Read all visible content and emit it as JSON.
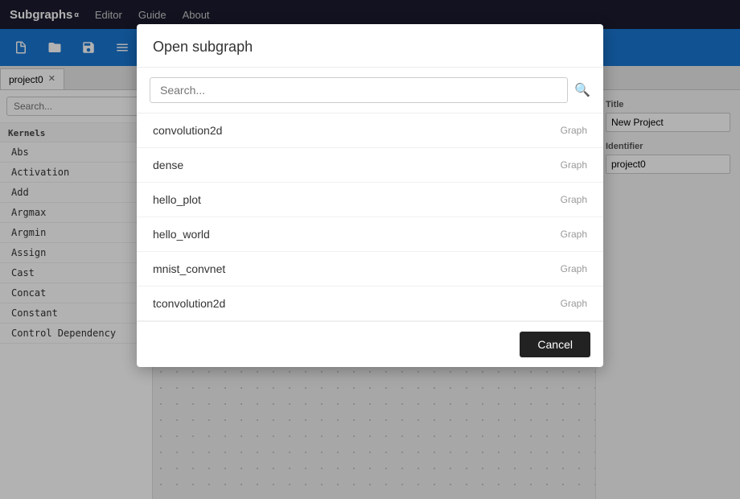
{
  "nav": {
    "brand": "Subgraphs",
    "brand_sup": "α",
    "links": [
      "Editor",
      "Guide",
      "About"
    ]
  },
  "toolbar": {
    "icons": [
      {
        "name": "new-file-icon",
        "symbol": "📄"
      },
      {
        "name": "open-folder-icon",
        "symbol": "📁"
      },
      {
        "name": "save-icon",
        "symbol": "💾"
      },
      {
        "name": "extra-icon",
        "symbol": "📋"
      }
    ]
  },
  "tabs": [
    {
      "label": "project0",
      "closeable": true,
      "active": true
    }
  ],
  "sidebar": {
    "search_placeholder": "Search...",
    "section_label": "Kernels",
    "items": [
      "Abs",
      "Activation",
      "Add",
      "Argmax",
      "Argmin",
      "Assign",
      "Cast",
      "Concat",
      "Constant",
      "Control Dependency"
    ]
  },
  "right_panel": {
    "title_label": "Title",
    "title_value": "New Project",
    "identifier_label": "Identifier",
    "identifier_value": "project0"
  },
  "modal": {
    "title": "Open subgraph",
    "search_placeholder": "Search...",
    "items": [
      {
        "name": "convolution2d",
        "type": "Graph"
      },
      {
        "name": "dense",
        "type": "Graph"
      },
      {
        "name": "hello_plot",
        "type": "Graph"
      },
      {
        "name": "hello_world",
        "type": "Graph"
      },
      {
        "name": "mnist_convnet",
        "type": "Graph"
      },
      {
        "name": "tconvolution2d",
        "type": "Graph"
      }
    ],
    "cancel_label": "Cancel"
  }
}
